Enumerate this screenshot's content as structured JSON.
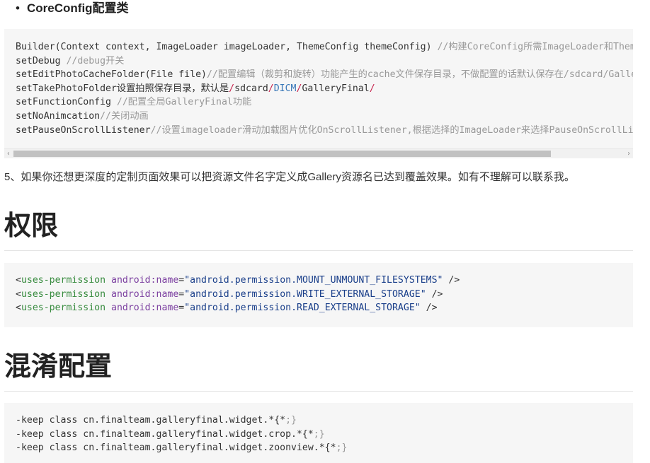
{
  "bullet": {
    "marker": "•",
    "text": "CoreConfig配置类"
  },
  "code_block_1": {
    "lines": [
      {
        "code": "Builder(Context context, ImageLoader imageLoader, ThemeConfig themeConfig) ",
        "comment": "//构建CoreConfig所需ImageLoader和ThemeConfig"
      },
      {
        "code": "setDebug ",
        "comment": "//debug开关"
      },
      {
        "code": "setEditPhotoCacheFolder(File file)",
        "comment": "//配置编辑（裁剪和旋转）功能产生的cache文件保存目录，不做配置的话默认保存在/sdcard/GalleryFinal/edittemp/"
      },
      {
        "code_a": "setTakePhotoFolder设置拍照保存目录，默认是",
        "code_b": "/",
        "code_c": "sdcard",
        "code_d": "/",
        "code_e": "DICM",
        "code_f": "/",
        "code_g": "GalleryFinal",
        "code_h": "/"
      },
      {
        "code": "setFunctionConfig ",
        "comment": "//配置全局GalleryFinal功能"
      },
      {
        "code": "setNoAnimcation",
        "comment": "//关闭动画"
      },
      {
        "code": "setPauseOnScrollListener",
        "comment": "//设置imageloader滑动加载图片优化OnScrollListener,根据选择的ImageLoader来选择PauseOnScrollListener"
      }
    ],
    "scroll_left": "‹",
    "scroll_right": "›"
  },
  "paragraph": "5、如果你还想更深度的定制页面效果可以把资源文件名字定义成Gallery资源名已达到覆盖效果。如有不理解可以联系我。",
  "heading_permissions": "权限",
  "code_block_2": {
    "lines": [
      {
        "lt": "<",
        "tag": "uses-permission",
        "attr": "android:name",
        "eq": "=",
        "value": "\"android.permission.MOUNT_UNMOUNT_FILESYSTEMS\"",
        "end": " />"
      },
      {
        "lt": "<",
        "tag": "uses-permission",
        "attr": "android:name",
        "eq": "=",
        "value": "\"android.permission.WRITE_EXTERNAL_STORAGE\"",
        "end": " />"
      },
      {
        "lt": "<",
        "tag": "uses-permission",
        "attr": "android:name",
        "eq": "=",
        "value": "\"android.permission.READ_EXTERNAL_STORAGE\"",
        "end": " />"
      }
    ]
  },
  "heading_obfuscation": "混淆配置",
  "code_block_3": {
    "lines": [
      {
        "code": "-keep class cn.finalteam.galleryfinal.widget.*{*",
        "punct": ";}"
      },
      {
        "code": "-keep class cn.finalteam.galleryfinal.widget.crop.*{*",
        "punct": ";}"
      },
      {
        "code": "-keep class cn.finalteam.galleryfinal.widget.zoonview.*{*",
        "punct": ";}"
      }
    ]
  }
}
